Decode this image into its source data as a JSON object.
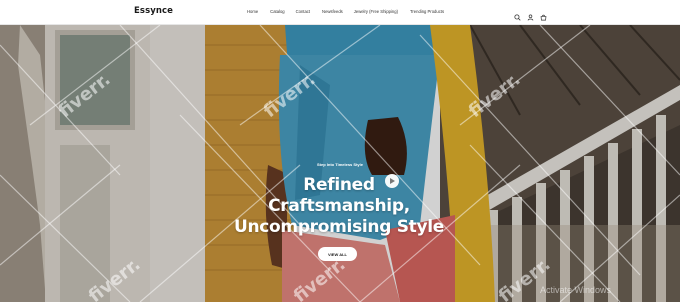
{
  "header": {
    "logo": "Essynce",
    "nav": [
      "Home",
      "Catalog",
      "Contact",
      "Newsfeeds",
      "Jewelry (Free Shipping)",
      "Trending Products"
    ],
    "icons": [
      "search-icon",
      "account-icon",
      "cart-icon"
    ]
  },
  "hero": {
    "eyebrow": "Step Into Timeless Style",
    "headline_lines": [
      "Refined",
      "Craftsmanship,",
      "Uncompromising Style"
    ],
    "cta_label": "VIEW ALL"
  },
  "overlay": {
    "watermark_text": "fiverr.",
    "system_notice": "Activate Windows"
  },
  "colors": {
    "header_bg": "#ffffff",
    "text_dark": "#1a1a1a",
    "hero_text": "#ffffff",
    "cta_bg": "#ffffff"
  }
}
